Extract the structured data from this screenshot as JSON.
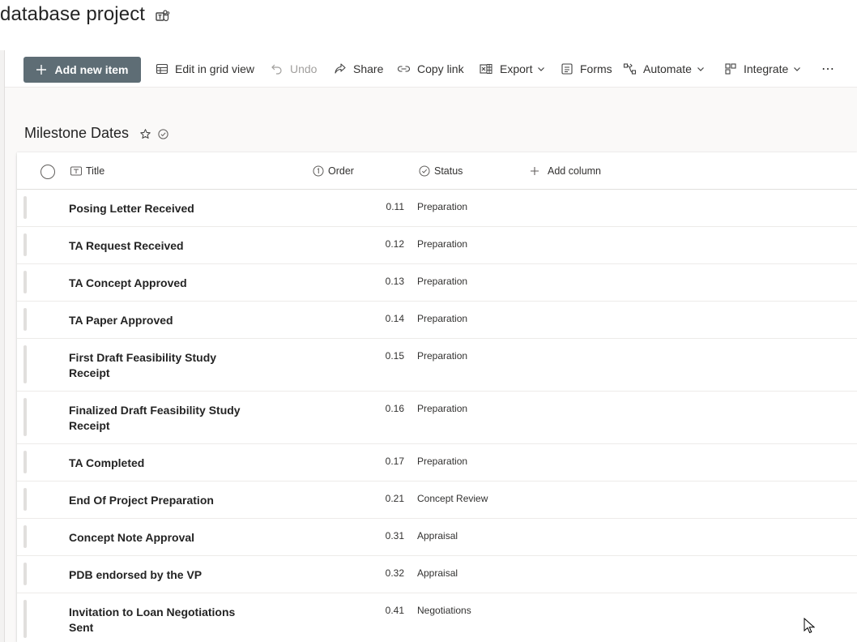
{
  "site": {
    "title": "database project",
    "teams_icon": "teams-icon"
  },
  "command_bar": {
    "add_new_item": "Add new item",
    "edit_grid": "Edit in grid view",
    "undo": "Undo",
    "share": "Share",
    "copy_link": "Copy link",
    "export": "Export",
    "forms": "Forms",
    "automate": "Automate",
    "integrate": "Integrate",
    "more": "⋯"
  },
  "list": {
    "title": "Milestone Dates",
    "columns": {
      "title": "Title",
      "order": "Order",
      "status": "Status",
      "add_column": "Add column"
    },
    "rows": [
      {
        "title": "Posing Letter Received",
        "order": "0.11",
        "status": "Preparation"
      },
      {
        "title": "TA Request Received",
        "order": "0.12",
        "status": "Preparation"
      },
      {
        "title": "TA Concept Approved",
        "order": "0.13",
        "status": "Preparation"
      },
      {
        "title": "TA Paper Approved",
        "order": "0.14",
        "status": "Preparation"
      },
      {
        "title": "First Draft Feasibility Study Receipt",
        "order": "0.15",
        "status": "Preparation"
      },
      {
        "title": "Finalized Draft Feasibility Study Receipt",
        "order": "0.16",
        "status": "Preparation"
      },
      {
        "title": "TA Completed",
        "order": "0.17",
        "status": "Preparation"
      },
      {
        "title": "End Of Project Preparation",
        "order": "0.21",
        "status": "Concept Review"
      },
      {
        "title": "Concept Note Approval",
        "order": "0.31",
        "status": "Appraisal"
      },
      {
        "title": "PDB endorsed by the VP",
        "order": "0.32",
        "status": "Appraisal"
      },
      {
        "title": "Invitation to Loan Negotiations Sent",
        "order": "0.41",
        "status": "Negotiations"
      }
    ]
  },
  "colors": {
    "primary_button": "#5e6d75",
    "row_bar": "#e1dfdd",
    "page_bg": "#faf9f8"
  }
}
